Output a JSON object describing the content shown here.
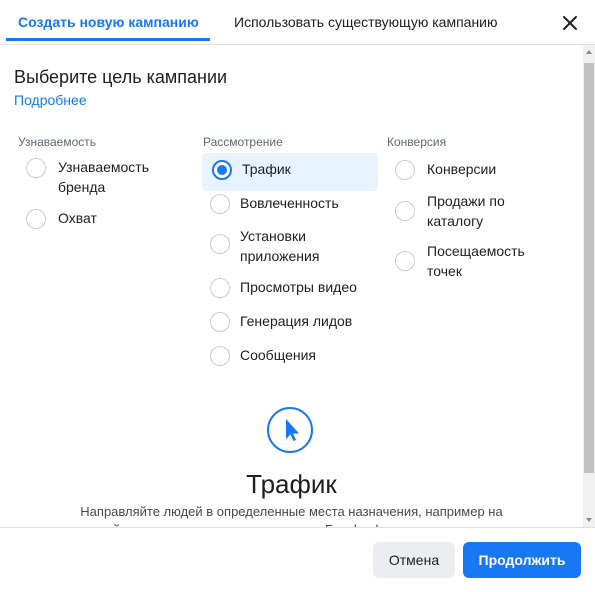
{
  "tabs": {
    "create_new": "Создать новую кампанию",
    "use_existing": "Использовать существующую кампанию"
  },
  "header": {
    "title": "Выберите цель кампании",
    "learn_more": "Подробнее"
  },
  "columns": [
    {
      "title": "Узнаваемость",
      "options": [
        {
          "label": "Узнаваемость бренда",
          "selected": false
        },
        {
          "label": "Охват",
          "selected": false
        }
      ]
    },
    {
      "title": "Рассмотрение",
      "options": [
        {
          "label": "Трафик",
          "selected": true
        },
        {
          "label": "Вовлеченность",
          "selected": false
        },
        {
          "label": "Установки приложения",
          "selected": false
        },
        {
          "label": "Просмотры видео",
          "selected": false
        },
        {
          "label": "Генерация лидов",
          "selected": false
        },
        {
          "label": "Сообщения",
          "selected": false
        }
      ]
    },
    {
      "title": "Конверсия",
      "options": [
        {
          "label": "Конверсии",
          "selected": false
        },
        {
          "label": "Продажи по каталогу",
          "selected": false
        },
        {
          "label": "Посещаемость точек",
          "selected": false
        }
      ]
    }
  ],
  "selected_objective": {
    "icon": "cursor-icon",
    "title": "Трафик",
    "description": "Направляйте людей в определенные места назначения, например на сайт, в приложение, мероприятие на Facebook или переписку в"
  },
  "footer": {
    "cancel_label": "Отмена",
    "continue_label": "Продолжить"
  },
  "colors": {
    "accent": "#1877f2",
    "selected_bg": "#e7f3ff"
  }
}
